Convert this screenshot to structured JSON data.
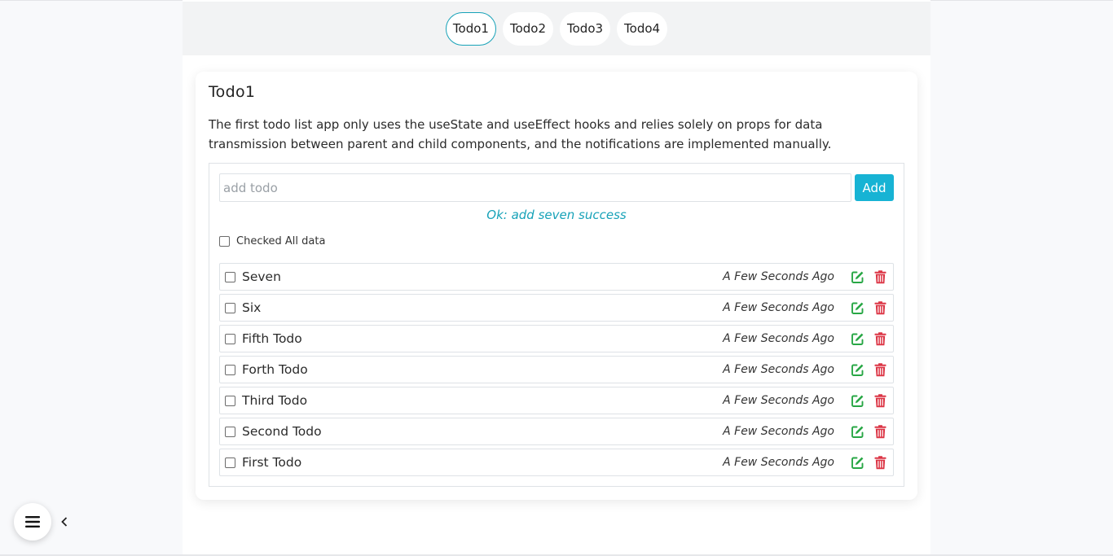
{
  "nav": {
    "tabs": [
      {
        "label": "Todo1",
        "active": true
      },
      {
        "label": "Todo2",
        "active": false
      },
      {
        "label": "Todo3",
        "active": false
      },
      {
        "label": "Todo4",
        "active": false
      }
    ]
  },
  "card": {
    "title": "Todo1",
    "description": "The first todo list app only uses the useState and useEffect hooks and relies solely on props for data transmission between parent and child components, and the notifications are implemented manually."
  },
  "form": {
    "input_value": "",
    "input_placeholder": "add todo",
    "add_label": "Add",
    "message": "Ok: add seven success"
  },
  "check_all_label": "Checked All data",
  "todos": [
    {
      "text": "Seven",
      "time": "A Few Seconds Ago"
    },
    {
      "text": "Six",
      "time": "A Few Seconds Ago"
    },
    {
      "text": "Fifth Todo",
      "time": "A Few Seconds Ago"
    },
    {
      "text": "Forth Todo",
      "time": "A Few Seconds Ago"
    },
    {
      "text": "Third Todo",
      "time": "A Few Seconds Ago"
    },
    {
      "text": "Second Todo",
      "time": "A Few Seconds Ago"
    },
    {
      "text": "First Todo",
      "time": "A Few Seconds Ago"
    }
  ],
  "icons": {
    "edit": "edit-icon",
    "delete": "trash-icon",
    "menu": "hamburger-menu-icon",
    "collapse": "chevron-left-icon"
  },
  "colors": {
    "accent": "#17a2b8",
    "add_button": "#17b3d4",
    "edit": "#28a745",
    "delete": "#dc3545"
  }
}
